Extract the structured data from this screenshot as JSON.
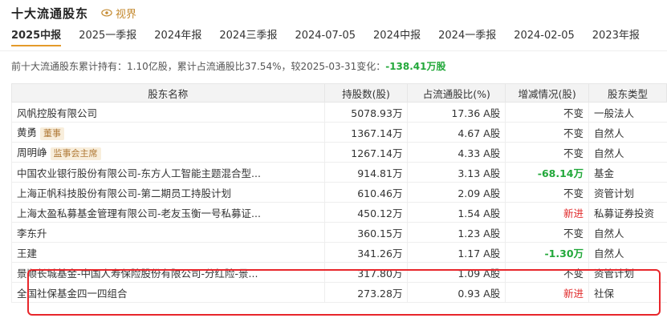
{
  "header": {
    "title": "十大流通股东",
    "view_label": "视界"
  },
  "tabs": [
    "2025中报",
    "2025一季报",
    "2024年报",
    "2024三季报",
    "2024-07-05",
    "2024中报",
    "2024一季报",
    "2024-02-05",
    "2023年报"
  ],
  "summary": {
    "text": "前十大流通股东累计持有：1.10亿股，累计占流通股比37.54%，较2025-03-31变化：",
    "change": "-138.41万股"
  },
  "table": {
    "headers": [
      "股东名称",
      "持股数(股)",
      "占流通股比(%)",
      "增减情况(股)",
      "股东类型"
    ],
    "rows": [
      {
        "name": "风帆控股有限公司",
        "badge": "",
        "shares": "5078.93万",
        "ratio": "17.36 A股",
        "change": "不变",
        "type": "一般法人"
      },
      {
        "name": "黄勇",
        "badge": "董事",
        "shares": "1367.14万",
        "ratio": "4.67 A股",
        "change": "不变",
        "type": "自然人"
      },
      {
        "name": "周明峥",
        "badge": "监事会主席",
        "shares": "1267.14万",
        "ratio": "4.33 A股",
        "change": "不变",
        "type": "自然人"
      },
      {
        "name": "中国农业银行股份有限公司-东方人工智能主题混合型...",
        "badge": "",
        "shares": "914.81万",
        "ratio": "3.13 A股",
        "change": "-68.14万",
        "type": "基金"
      },
      {
        "name": "上海正帆科技股份有限公司-第二期员工持股计划",
        "badge": "",
        "shares": "610.46万",
        "ratio": "2.09 A股",
        "change": "不变",
        "type": "资管计划"
      },
      {
        "name": "上海太盈私募基金管理有限公司-老友玉衡一号私募证...",
        "badge": "",
        "shares": "450.12万",
        "ratio": "1.54 A股",
        "change": "新进",
        "type": "私募证券投资"
      },
      {
        "name": "李东升",
        "badge": "",
        "shares": "360.15万",
        "ratio": "1.23 A股",
        "change": "不变",
        "type": "自然人"
      },
      {
        "name": "王建",
        "badge": "",
        "shares": "341.26万",
        "ratio": "1.17 A股",
        "change": "-1.30万",
        "type": "自然人"
      },
      {
        "name": "景顺长城基金-中国人寿保险股份有限公司-分红险-景...",
        "badge": "",
        "shares": "317.80万",
        "ratio": "1.09 A股",
        "change": "不变",
        "type": "资管计划"
      },
      {
        "name": "全国社保基金四一四组合",
        "badge": "",
        "shares": "273.28万",
        "ratio": "0.93 A股",
        "change": "新进",
        "type": "社保"
      }
    ]
  },
  "colors": {
    "accent": "#e49a2b",
    "down": "#22a83a",
    "up": "#e0292a",
    "highlight_box": "#e8262b"
  }
}
